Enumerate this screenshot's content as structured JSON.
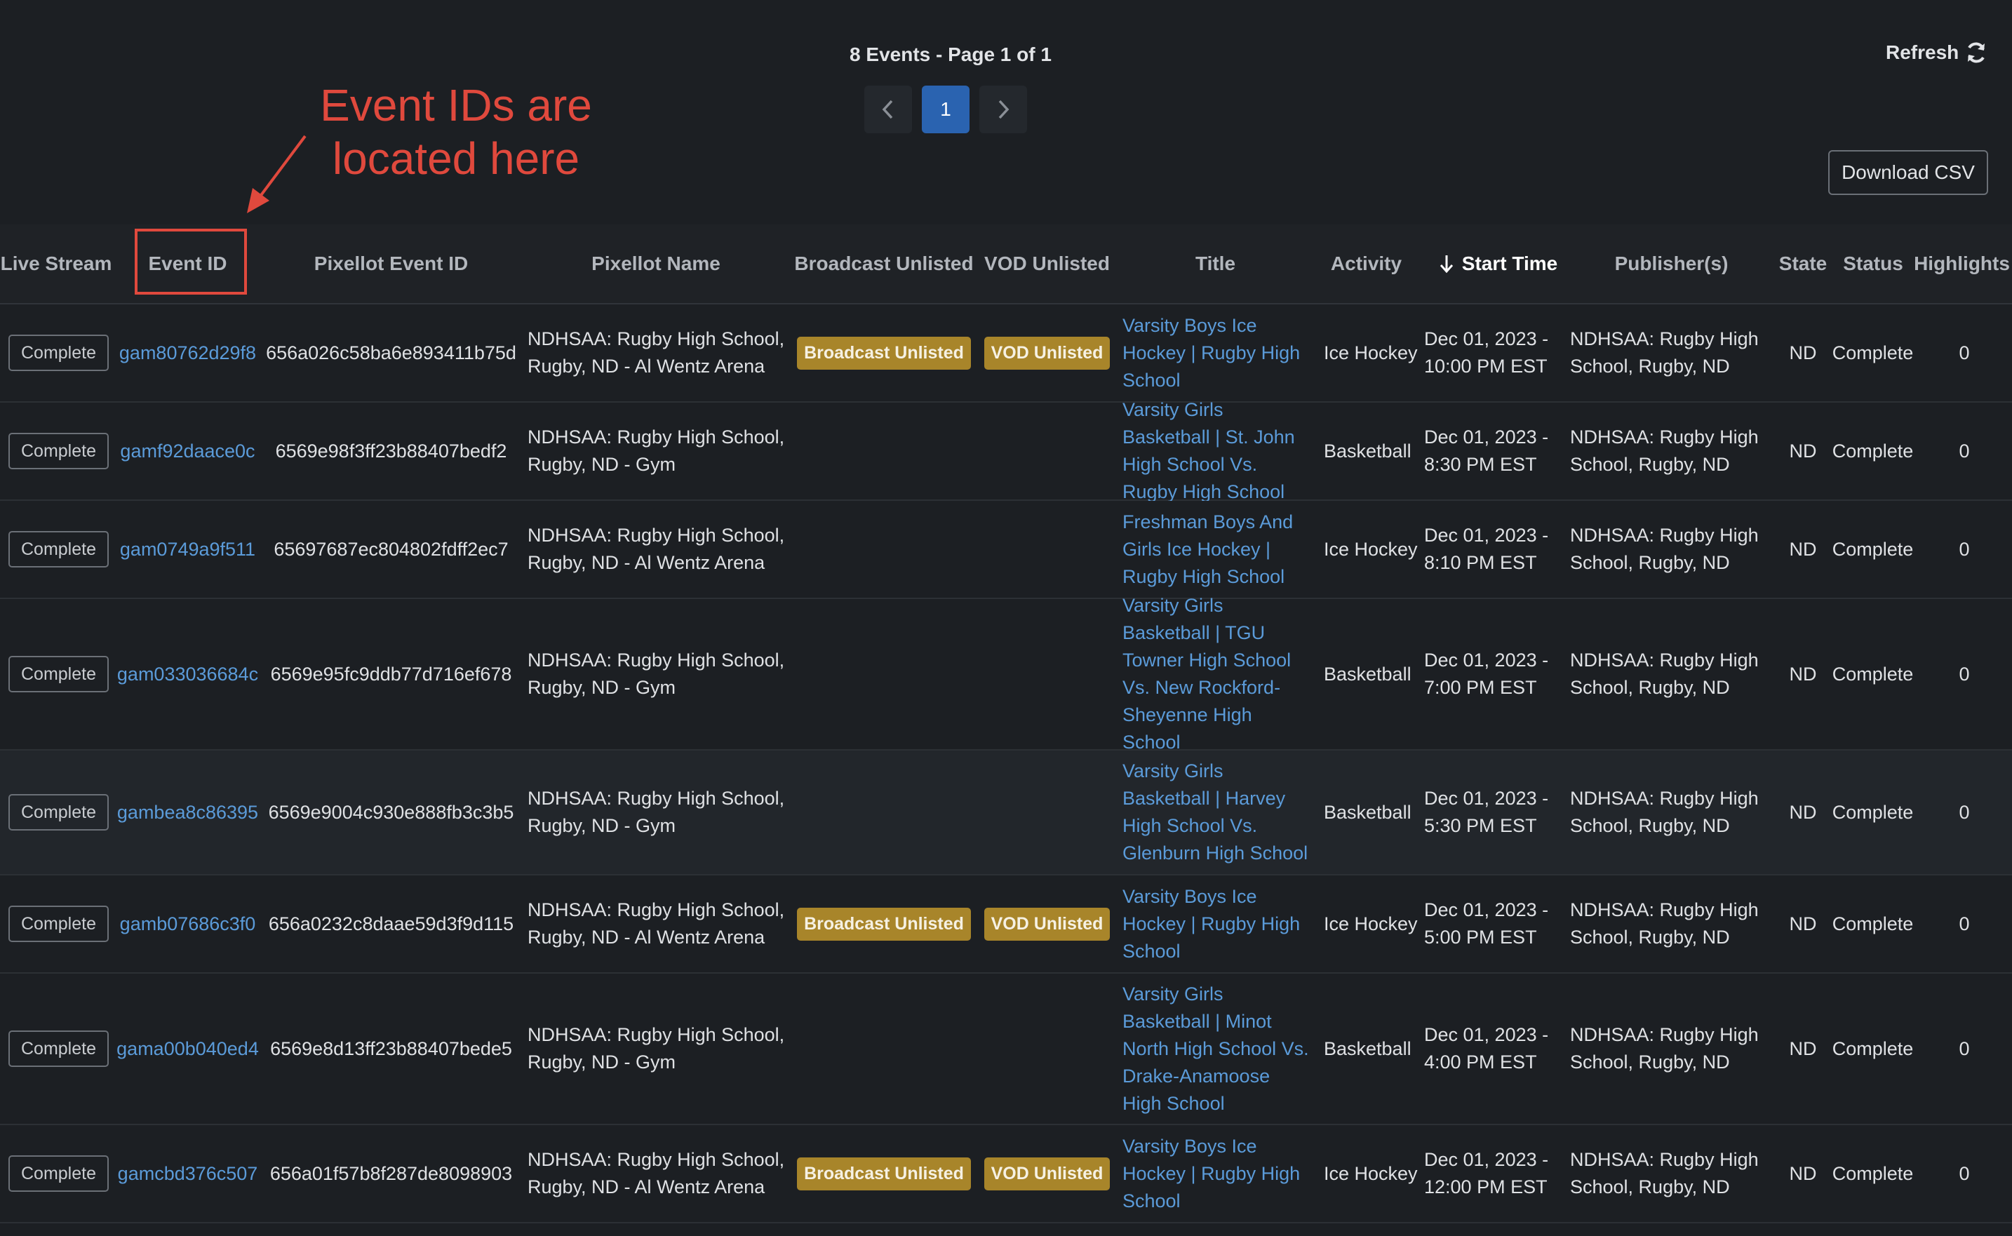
{
  "pagination": {
    "summary": "8 Events - Page 1 of 1",
    "current_page": "1"
  },
  "toolbar": {
    "refresh_label": "Refresh",
    "download_csv_label": "Download CSV"
  },
  "annotation": {
    "line1": "Event IDs are",
    "line2": "located here"
  },
  "columns": {
    "live_stream": "Live Stream",
    "event_id": "Event ID",
    "pixellot_event_id": "Pixellot Event ID",
    "pixellot_name": "Pixellot Name",
    "broadcast_unlisted": "Broadcast Unlisted",
    "vod_unlisted": "VOD Unlisted",
    "title": "Title",
    "activity": "Activity",
    "start_time": "Start Time",
    "publishers": "Publisher(s)",
    "state": "State",
    "status": "Status",
    "highlights": "Highlights"
  },
  "colors": {
    "accent": "#2a63b0",
    "link": "#5b9bd9",
    "badge": "#a8852a",
    "annotation": "#e0493d"
  },
  "rows": [
    {
      "live_stream": "Complete",
      "event_id": "gam80762d29f8",
      "pixellot_event_id": "656a026c58ba6e893411b75d",
      "pixellot_name": "NDHSAA: Rugby High School, Rugby, ND - Al Wentz Arena",
      "broadcast_unlisted": "Broadcast Unlisted",
      "vod_unlisted": "VOD Unlisted",
      "title": "Varsity Boys Ice Hockey | Rugby High School",
      "activity": "Ice Hockey",
      "start_time": "Dec 01, 2023 - 10:00 PM EST",
      "publishers": "NDHSAA: Rugby High School, Rugby, ND",
      "state": "ND",
      "status": "Complete",
      "highlights": "0"
    },
    {
      "live_stream": "Complete",
      "event_id": "gamf92daace0c",
      "pixellot_event_id": "6569e98f3ff23b88407bedf2",
      "pixellot_name": "NDHSAA: Rugby High School, Rugby, ND - Gym",
      "broadcast_unlisted": "",
      "vod_unlisted": "",
      "title": "Varsity Girls Basketball | St. John High School Vs. Rugby High School",
      "activity": "Basketball",
      "start_time": "Dec 01, 2023 - 8:30 PM EST",
      "publishers": "NDHSAA: Rugby High School, Rugby, ND",
      "state": "ND",
      "status": "Complete",
      "highlights": "0"
    },
    {
      "live_stream": "Complete",
      "event_id": "gam0749a9f511",
      "pixellot_event_id": "65697687ec804802fdff2ec7",
      "pixellot_name": "NDHSAA: Rugby High School, Rugby, ND - Al Wentz Arena",
      "broadcast_unlisted": "",
      "vod_unlisted": "",
      "title": "Freshman Boys And Girls Ice Hockey | Rugby High School",
      "activity": "Ice Hockey",
      "start_time": "Dec 01, 2023 - 8:10 PM EST",
      "publishers": "NDHSAA: Rugby High School, Rugby, ND",
      "state": "ND",
      "status": "Complete",
      "highlights": "0"
    },
    {
      "live_stream": "Complete",
      "event_id": "gam033036684c",
      "pixellot_event_id": "6569e95fc9ddb77d716ef678",
      "pixellot_name": "NDHSAA: Rugby High School, Rugby, ND - Gym",
      "broadcast_unlisted": "",
      "vod_unlisted": "",
      "title": "Varsity Girls Basketball | TGU Towner High School Vs. New Rockford-Sheyenne High School",
      "activity": "Basketball",
      "start_time": "Dec 01, 2023 - 7:00 PM EST",
      "publishers": "NDHSAA: Rugby High School, Rugby, ND",
      "state": "ND",
      "status": "Complete",
      "highlights": "0"
    },
    {
      "live_stream": "Complete",
      "event_id": "gambea8c86395",
      "pixellot_event_id": "6569e9004c930e888fb3c3b5",
      "pixellot_name": "NDHSAA: Rugby High School, Rugby, ND - Gym",
      "broadcast_unlisted": "",
      "vod_unlisted": "",
      "title": "Varsity Girls Basketball | Harvey High School Vs. Glenburn High School",
      "activity": "Basketball",
      "start_time": "Dec 01, 2023 - 5:30 PM EST",
      "publishers": "NDHSAA: Rugby High School, Rugby, ND",
      "state": "ND",
      "status": "Complete",
      "highlights": "0"
    },
    {
      "live_stream": "Complete",
      "event_id": "gamb07686c3f0",
      "pixellot_event_id": "656a0232c8daae59d3f9d115",
      "pixellot_name": "NDHSAA: Rugby High School, Rugby, ND - Al Wentz Arena",
      "broadcast_unlisted": "Broadcast Unlisted",
      "vod_unlisted": "VOD Unlisted",
      "title": "Varsity Boys Ice Hockey | Rugby High School",
      "activity": "Ice Hockey",
      "start_time": "Dec 01, 2023 - 5:00 PM EST",
      "publishers": "NDHSAA: Rugby High School, Rugby, ND",
      "state": "ND",
      "status": "Complete",
      "highlights": "0"
    },
    {
      "live_stream": "Complete",
      "event_id": "gama00b040ed4",
      "pixellot_event_id": "6569e8d13ff23b88407bede5",
      "pixellot_name": "NDHSAA: Rugby High School, Rugby, ND - Gym",
      "broadcast_unlisted": "",
      "vod_unlisted": "",
      "title": "Varsity Girls Basketball | Minot North High School Vs. Drake-Anamoose High School",
      "activity": "Basketball",
      "start_time": "Dec 01, 2023 - 4:00 PM EST",
      "publishers": "NDHSAA: Rugby High School, Rugby, ND",
      "state": "ND",
      "status": "Complete",
      "highlights": "0"
    },
    {
      "live_stream": "Complete",
      "event_id": "gamcbd376c507",
      "pixellot_event_id": "656a01f57b8f287de8098903",
      "pixellot_name": "NDHSAA: Rugby High School, Rugby, ND - Al Wentz Arena",
      "broadcast_unlisted": "Broadcast Unlisted",
      "vod_unlisted": "VOD Unlisted",
      "title": "Varsity Boys Ice Hockey | Rugby High School",
      "activity": "Ice Hockey",
      "start_time": "Dec 01, 2023 - 12:00 PM EST",
      "publishers": "NDHSAA: Rugby High School, Rugby, ND",
      "state": "ND",
      "status": "Complete",
      "highlights": "0"
    }
  ]
}
